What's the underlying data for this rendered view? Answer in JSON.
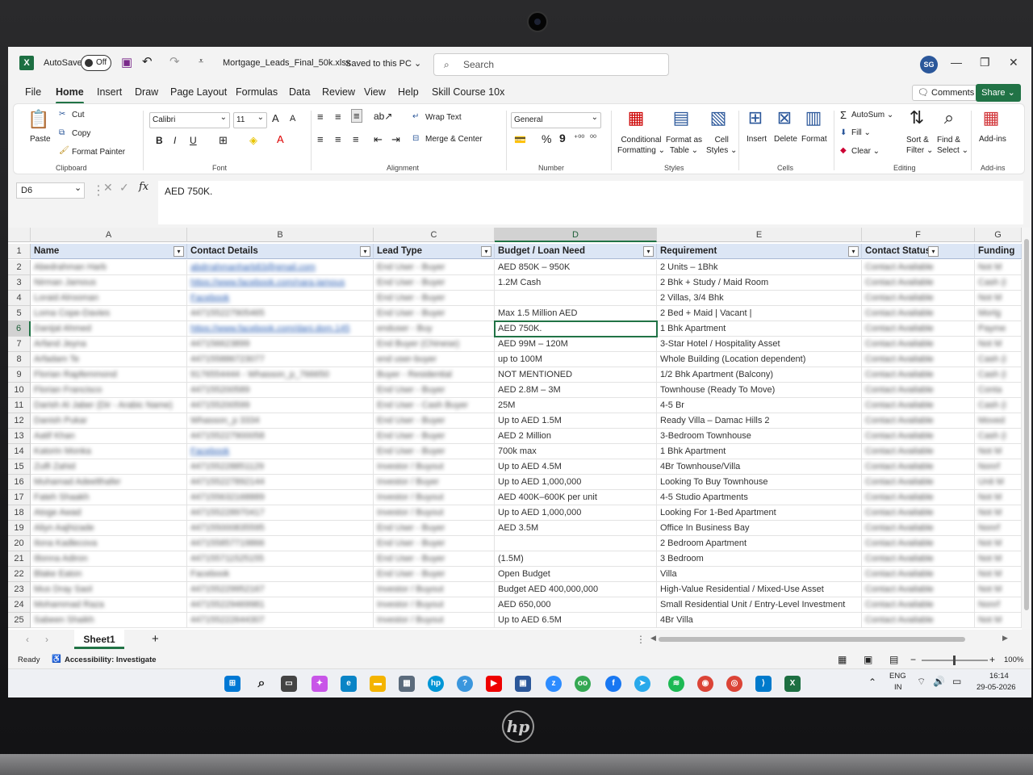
{
  "titlebar": {
    "app_icon": "X",
    "autosave_label": "AutoSave",
    "autosave_state": "Off",
    "filename": "Mortgage_Leads_Final_50k.xlsx",
    "save_status": "Saved to this PC ⌄",
    "search_placeholder": "Search",
    "user_initials": "SG",
    "minimize": "—",
    "restore": "❐",
    "close": "✕"
  },
  "menu": {
    "items": [
      "File",
      "Home",
      "Insert",
      "Draw",
      "Page Layout",
      "Formulas",
      "Data",
      "Review",
      "View",
      "Help",
      "Skill Course 10x"
    ],
    "comments_label": "Comments",
    "share_label": "Share ⌄"
  },
  "ribbon": {
    "clipboard": {
      "paste": "Paste",
      "cut": "Cut",
      "copy": "Copy",
      "format_painter": "Format Painter",
      "group": "Clipboard"
    },
    "font": {
      "name": "Calibri",
      "size": "11",
      "bold": "B",
      "italic": "I",
      "underline": "U",
      "grow": "A",
      "shrink": "A",
      "group": "Font"
    },
    "alignment": {
      "wrap_text": "Wrap Text",
      "merge_center": "Merge & Center",
      "group": "Alignment"
    },
    "number": {
      "format": "General",
      "percent": "%",
      "comma": "9",
      "group": "Number"
    },
    "styles": {
      "conditional": "Conditional\nFormatting ⌄",
      "format_table": "Format as\nTable ⌄",
      "cell_styles": "Cell\nStyles ⌄",
      "group": "Styles"
    },
    "cells": {
      "insert": "Insert",
      "delete": "Delete",
      "format": "Format",
      "group": "Cells"
    },
    "editing": {
      "autosum": "AutoSum ⌄",
      "fill": "Fill ⌄",
      "clear": "Clear ⌄",
      "sort_filter": "Sort &\nFilter ⌄",
      "find_select": "Find &\nSelect ⌄",
      "group": "Editing"
    },
    "addins": {
      "label": "Add-ins",
      "group": "Add-ins"
    }
  },
  "formula_bar": {
    "name_box": "D6",
    "content": "AED 750K."
  },
  "columns": [
    "A",
    "B",
    "C",
    "D",
    "E",
    "F",
    "G"
  ],
  "headers": [
    "Name",
    "Contact Details",
    "Lead Type",
    "Budget / Loan Need",
    "Requirement",
    "Contact Status",
    "Funding"
  ],
  "rows": [
    {
      "n": "2",
      "a": "Abedrahman Harb",
      "b": "abdrrahmanharb83@gmail.com",
      "b_link": true,
      "c": "End User - Buyer",
      "d": "AED 850K – 950K",
      "e": "2 Units – 1Bhk",
      "f": "Contact Available",
      "g": "Not M"
    },
    {
      "n": "3",
      "a": "Nirman Jamous",
      "b": "https://www.facebook.com/nara.jamous",
      "b_link": true,
      "c": "End User - Buyer",
      "d": "1.2M Cash",
      "e": "2 Bhk + Study / Maid Room",
      "f": "Contact Available",
      "g": "Cash (i"
    },
    {
      "n": "4",
      "a": "Loraid Alrooman",
      "b": "Facebook",
      "b_link": true,
      "c": "End User - Buyer",
      "d": "",
      "e": "2 Villas, 3/4 Bhk",
      "f": "Contact Available",
      "g": "Not M"
    },
    {
      "n": "5",
      "a": "Loma Cope-Davies",
      "b": "447155227905465",
      "b_link": false,
      "c": "End User - Buyer",
      "d": "Max 1.5 Million AED",
      "e": "2 Bed + Maid | Vacant |",
      "f": "Contact Available",
      "g": "Mortg"
    },
    {
      "n": "6",
      "a": "Danijal Ahmed",
      "b": "https://www.facebook.com/dani.dom.145",
      "b_link": true,
      "c": "enduser - Buy",
      "d": "AED 750K.",
      "e": "1 Bhk Apartment",
      "f": "Contact Available",
      "g": "Payme"
    },
    {
      "n": "7",
      "a": "Arfand Jeyna",
      "b": "447156623899",
      "b_link": false,
      "c": "End Buyer (Chinese)",
      "d": "AED 99M – 120M",
      "e": "3-Star Hotel / Hospitality Asset",
      "f": "Contact Available",
      "g": "Not M"
    },
    {
      "n": "8",
      "a": "Arfadam Te",
      "b": "447155886723077",
      "b_link": false,
      "c": "end user-buyer",
      "d": "up to 100M",
      "e": "Whole Building (Location dependent)",
      "f": "Contact Available",
      "g": "Cash (i"
    },
    {
      "n": "9",
      "a": "Florian Rapfemmond",
      "b": "9176554444 - Whasson_p_766650",
      "b_link": false,
      "c": "Buyer - Residential",
      "d": "NOT MENTIONED",
      "e": "1/2 Bhk Apartment (Balcony)",
      "f": "Contact Available",
      "g": "Cash (i"
    },
    {
      "n": "10",
      "a": "Florian Francisco",
      "b": "447155200589",
      "b_link": false,
      "c": "End User - Buyer",
      "d": "AED 2.8M – 3M",
      "e": "Townhouse (Ready To Move)",
      "f": "Contact Available",
      "g": "Conta"
    },
    {
      "n": "11",
      "a": "Darish Al Jaber (Dir - Arabic Name)",
      "b": "447155200599",
      "b_link": false,
      "c": "End User - Cash Buyer",
      "d": "25M",
      "e": "4-5 Br",
      "f": "Contact Available",
      "g": "Cash (i"
    },
    {
      "n": "12",
      "a": "Danish Pukar",
      "b": "Whasson_p 3334",
      "b_link": false,
      "c": "End User - Buyer",
      "d": "Up to AED 1.5M",
      "e": "Ready Villa – Damac Hills 2",
      "f": "Contact Available",
      "g": "Moved"
    },
    {
      "n": "13",
      "a": "Aatif Khan",
      "b": "447155227900058",
      "b_link": false,
      "c": "End User - Buyer",
      "d": "AED 2 Million",
      "e": "3-Bedroom Townhouse",
      "f": "Contact Available",
      "g": "Cash (i"
    },
    {
      "n": "14",
      "a": "Katorin Monka",
      "b": "Facebook",
      "b_link": true,
      "c": "End User - Buyer",
      "d": "700k max",
      "e": "1 Bhk Apartment",
      "f": "Contact Available",
      "g": "Not M"
    },
    {
      "n": "15",
      "a": "Zulfi Zahid",
      "b": "447155228851129",
      "b_link": false,
      "c": "Investor / Buyout",
      "d": "Up to AED 4.5M",
      "e": "4Br Townhouse/Villa",
      "f": "Contact Available",
      "g": "Nonrf"
    },
    {
      "n": "16",
      "a": "Muhamad Adeelthafer",
      "b": "447155227892144",
      "b_link": false,
      "c": "Investor / Buyer",
      "d": "Up to AED 1,000,000",
      "e": "Looking To Buy Townhouse",
      "f": "Contact Available",
      "g": "Unit M"
    },
    {
      "n": "17",
      "a": "Fateh Shaakh",
      "b": "447155632168889",
      "b_link": false,
      "c": "Investor / Buyout",
      "d": "AED 400K–600K per unit",
      "e": "4-5 Studio Apartments",
      "f": "Contact Available",
      "g": "Not M"
    },
    {
      "n": "18",
      "a": "Atoge Awad",
      "b": "447155228970417",
      "b_link": false,
      "c": "Investor / Buyout",
      "d": "Up to AED 1,000,000",
      "e": "Looking For 1-Bed Apartment",
      "f": "Contact Available",
      "g": "Not M"
    },
    {
      "n": "19",
      "a": "Aliyn Aajhizade",
      "b": "447155000835595",
      "b_link": false,
      "c": "End User - Buyer",
      "d": "AED 3.5M",
      "e": "Office In Business Bay",
      "f": "Contact Available",
      "g": "Nonrf"
    },
    {
      "n": "20",
      "a": "Ilona Kadlecova",
      "b": "447155857719866",
      "b_link": false,
      "c": "End User - Buyer",
      "d": "",
      "e": "2 Bedroom Apartment",
      "f": "Contact Available",
      "g": "Not M"
    },
    {
      "n": "21",
      "a": "Illonna Adiron",
      "b": "447155711525155",
      "b_link": false,
      "c": "End User - Buyer",
      "d": "(1.5M)",
      "e": "3 Bedroom",
      "f": "Contact Available",
      "g": "Not M"
    },
    {
      "n": "22",
      "a": "Blake Eaton",
      "b": "Facebook",
      "b_link": false,
      "c": "End User - Buyer",
      "d": "Open Budget",
      "e": "Villa",
      "f": "Contact Available",
      "g": "Not M"
    },
    {
      "n": "23",
      "a": "Mus Dray Saol",
      "b": "447155229952167",
      "b_link": false,
      "c": "Investor / Buyout",
      "d": "Budget AED 400,000,000",
      "e": "High-Value Residential / Mixed-Use Asset",
      "f": "Contact Available",
      "g": "Not M"
    },
    {
      "n": "24",
      "a": "Mohammad Raza",
      "b": "447155229469981",
      "b_link": false,
      "c": "Investor / Buyout",
      "d": "AED 650,000",
      "e": "Small Residential Unit / Entry-Level Investment",
      "f": "Contact Available",
      "g": "Nonrf"
    },
    {
      "n": "25",
      "a": "Sabeen Shaikh",
      "b": "447155222644307",
      "b_link": false,
      "c": "Investor / Buyout",
      "d": "Up to AED 6.5M",
      "e": "4Br Villa",
      "f": "Contact Available",
      "g": "Not M"
    }
  ],
  "sheetbar": {
    "sheet_name": "Sheet1",
    "add_sheet": "+"
  },
  "statusbar": {
    "ready": "Ready",
    "accessibility": "Accessibility: Investigate",
    "zoom": "100%"
  },
  "taskbar": {
    "lang": "ENG",
    "region": "IN",
    "time": "16:14",
    "date": "29-05-2026"
  },
  "colors": {
    "accent": "#217346",
    "header_fill": "#dce6f5"
  }
}
